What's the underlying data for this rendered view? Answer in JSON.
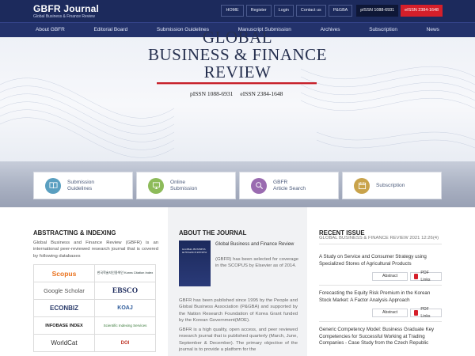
{
  "header": {
    "logo_title": "GBFR Journal",
    "logo_sub": "Global Business & Finance Review",
    "utils": [
      "HOME",
      "Register",
      "Login",
      "Contact us",
      "P&GBA"
    ],
    "pissn": "pISSN 1088-6931",
    "eissn": "eISSN 2384-1648"
  },
  "nav": [
    "About GBFR",
    "Editorial Board",
    "Submission Guidelines",
    "Manuscript Submission",
    "Archives",
    "Subscription",
    "News"
  ],
  "hero": {
    "line1": "GLOBAL",
    "line2": "BUSINESS & FINANCE",
    "line3": "REVIEW",
    "pissn": "pISSN 1088-6931",
    "eissn": "eISSN 2384-1648"
  },
  "quick": [
    {
      "line1": "Submission",
      "line2": "Guidelines",
      "icon": "book-icon",
      "color": "#5a9fc0"
    },
    {
      "line1": "Online",
      "line2": "Submission",
      "icon": "monitor-icon",
      "color": "#8dbb5a"
    },
    {
      "line1": "GBFR",
      "line2": "Article Search",
      "icon": "search-icon",
      "color": "#9a6bb0"
    },
    {
      "line1": "Subscription",
      "line2": "",
      "icon": "calendar-icon",
      "color": "#c9a34b"
    }
  ],
  "abstracting": {
    "heading": "ABSTRACTING & INDEXING",
    "text": "Global Business and Finance Review (GBFR) is an international peer-reviewed research journal that is covered by following databases",
    "logos": [
      "Scopus",
      "한국학술지인용색인 Korea Citation Index",
      "Google Scholar",
      "EBSCO",
      "ECONBIZ",
      "KOAJ",
      "INFOBASE INDEX",
      "Scientific Indexing Services",
      "WorldCat",
      "DOI"
    ]
  },
  "about": {
    "heading": "ABOUT THE JOURNAL",
    "cover_text": "GLOBAL BUSINESS & FINANCE REVIEW",
    "name": "Global Business and Finance Review",
    "p1": "(GBFR) has been selected for coverage in the SCOPUS by Elsevier as of 2014.",
    "p2": "GBFR has been published since 1995 by the People and Global Business Association (P&GBA) and supported by the Nation Research Foundation of Korea Grant funded by the Korean Government(MOE).",
    "p3": "GBFR is a high quality, open access, and peer reviewed research journal that is published quarterly (March, June, September & December). The primary objective of the journal is to provide a platform for the"
  },
  "recent": {
    "heading": "RECENT ISSUE",
    "sub": "GLOBAL BUSINESS & FINANCE REVIEW 2021 12:26(4)",
    "abstract_label": "Abstract",
    "pdf_label": "PDF Links",
    "articles": [
      "A Study on Service and Consumer Strategy using Specialized Stores of Agricultural Products",
      "Forecasting the Equity Risk Premium in the Korean Stock Market: A Factor Analysis Approach",
      "Generic Competency Model: Business Graduate Key Competencies for Successful Working at Trading Companies - Case Study from the Czech Republic"
    ]
  }
}
